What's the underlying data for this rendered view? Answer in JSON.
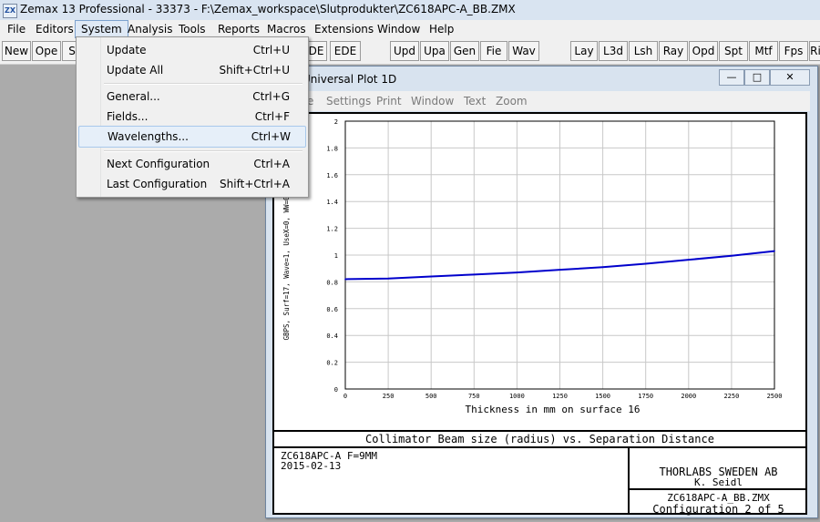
{
  "window": {
    "title": "Zemax 13 Professional - 33373 - F:\\Zemax_workspace\\Slutprodukter\\ZC618APC-A_BB.ZMX"
  },
  "app_icon_text": "ZX",
  "menubar": [
    "File",
    "Editors",
    "System",
    "Analysis",
    "Tools",
    "Reports",
    "Macros",
    "Extensions",
    "Window",
    "Help"
  ],
  "toolbar": {
    "left": [
      "New",
      "Ope",
      "S"
    ],
    "middle": [
      "DE",
      "EDE",
      "Upd",
      "Upa",
      "Gen",
      "Fie",
      "Wav"
    ],
    "right": [
      "Lay",
      "L3d",
      "Lsh",
      "Ray",
      "Opd",
      "Spt",
      "Mtf",
      "Fps",
      "Ri"
    ]
  },
  "system_menu": [
    {
      "label": "Update",
      "shortcut": "Ctrl+U"
    },
    {
      "label": "Update All",
      "shortcut": "Shift+Ctrl+U"
    },
    {
      "label": "General...",
      "shortcut": "Ctrl+G"
    },
    {
      "label": "Fields...",
      "shortcut": "Ctrl+F"
    },
    {
      "label": "Wavelengths...",
      "shortcut": "Ctrl+W"
    },
    {
      "label": "Next Configuration",
      "shortcut": "Ctrl+A"
    },
    {
      "label": "Last Configuration",
      "shortcut": "Shift+Ctrl+A"
    }
  ],
  "plot_window": {
    "title": "Universal Plot 1D",
    "controls": {
      "minimize": "—",
      "maximize": "□",
      "close": "✕"
    },
    "menu": [
      "e",
      "Settings",
      "Print",
      "Window",
      "Text",
      "Zoom"
    ]
  },
  "chart_data": {
    "type": "line",
    "xlabel": "Thickness in mm on surface 16",
    "ylabel": "GBPS, Surf=17, Wave=1, UseX=0, WW=0.0",
    "xlim": [
      0,
      2500
    ],
    "ylim": [
      0,
      2
    ],
    "x_ticks": [
      "0",
      "250",
      "500",
      "750",
      "1000",
      "1250",
      "1500",
      "1750",
      "2000",
      "2250",
      "2500"
    ],
    "y_ticks": [
      "0",
      "0.2",
      "0.4",
      "0.6",
      "0.8",
      "1",
      "1.2",
      "1.4",
      "1.6",
      "1.8",
      "2"
    ],
    "grid": true,
    "series": [
      {
        "color": "#0000cc",
        "x": [
          0,
          250,
          500,
          750,
          1000,
          1250,
          1500,
          1750,
          2000,
          2250,
          2500
        ],
        "y": [
          0.82,
          0.825,
          0.84,
          0.855,
          0.87,
          0.89,
          0.91,
          0.935,
          0.965,
          0.995,
          1.03
        ]
      }
    ]
  },
  "plot_caption": "Collimator Beam size (radius) vs. Separation Distance",
  "info_box": {
    "lens": "ZC618APC-A F=9MM",
    "date": "2015-02-13",
    "company": "THORLABS SWEDEN AB",
    "author": "K. Seidl",
    "file": "ZC618APC-A_BB.ZMX",
    "config": "Configuration 2 of 5"
  }
}
